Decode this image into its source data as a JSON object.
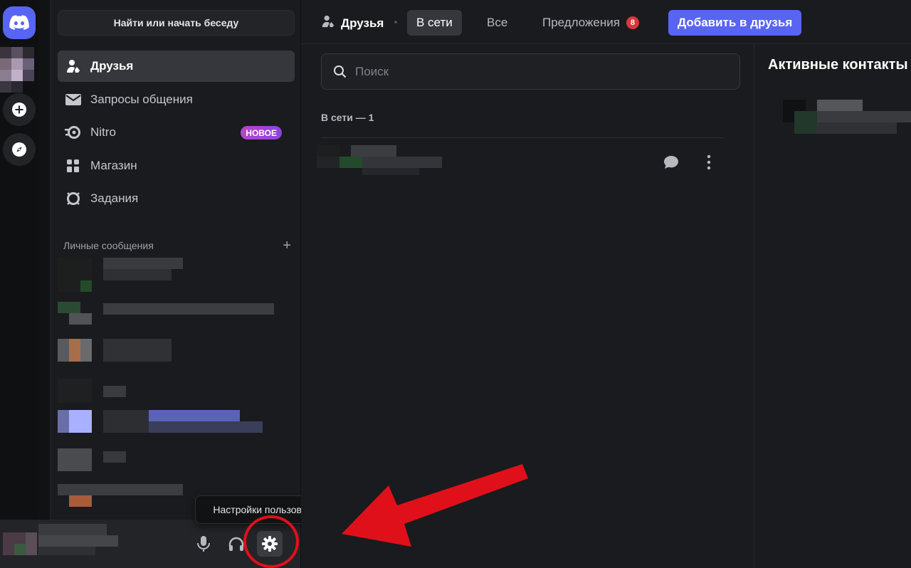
{
  "rail": {
    "home_icon": "discord-logo-icon",
    "add_server_icon": "plus-icon",
    "discover_icon": "compass-icon"
  },
  "sidebar": {
    "search_label": "Найти или начать беседу",
    "nav": [
      {
        "label": "Друзья",
        "icon": "friends-icon",
        "active": true
      },
      {
        "label": "Запросы общения",
        "icon": "envelope-icon"
      },
      {
        "label": "Nitro",
        "icon": "nitro-icon",
        "badge": "НОВОЕ"
      },
      {
        "label": "Магазин",
        "icon": "shop-icon"
      },
      {
        "label": "Задания",
        "icon": "quests-icon"
      }
    ],
    "dm_header": "Личные сообщения",
    "dm_add": "+"
  },
  "user_panel": {
    "mic_icon": "microphone-icon",
    "headphones_icon": "headphones-icon",
    "settings_icon": "gear-icon",
    "tooltip": "Настройки пользователя"
  },
  "topbar": {
    "title": "Друзья",
    "tabs": [
      {
        "label": "В сети",
        "active": true
      },
      {
        "label": "Все"
      },
      {
        "label": "Предложения",
        "count": "8"
      }
    ],
    "add_friend": "Добавить в друзья"
  },
  "main": {
    "search_placeholder": "Поиск",
    "online_label": "В сети — 1"
  },
  "active_now": {
    "title": "Активные контакты"
  },
  "colors": {
    "accent": "#5865f2",
    "badge_red": "#da373c",
    "annotation_red": "#e0101a"
  }
}
